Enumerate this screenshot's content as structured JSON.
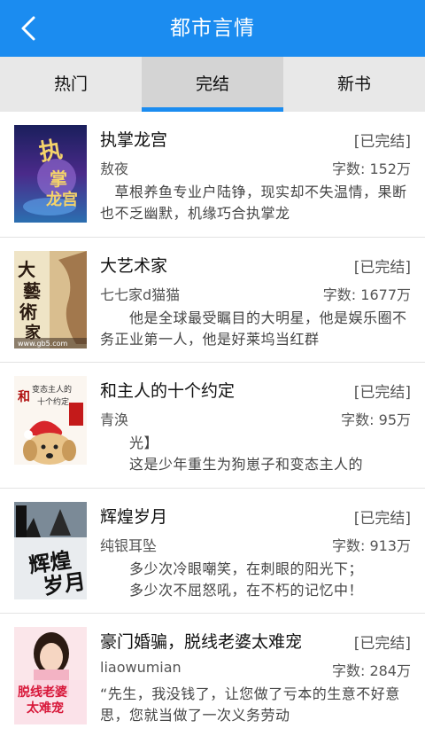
{
  "header": {
    "title": "都市言情",
    "back_icon": "chevron-left-icon"
  },
  "tabs": [
    {
      "label": "热门",
      "active": false
    },
    {
      "label": "完结",
      "active": true
    },
    {
      "label": "新书",
      "active": false
    }
  ],
  "books": [
    {
      "title": "执掌龙宫",
      "status": "[已完结]",
      "author": "敖夜",
      "word_count": "字数: 152万",
      "description": "　草根养鱼专业户陆铮，现实却不失温情，果断也不乏幽默，机缘巧合执掌龙",
      "cover_text": "执掌龙宫"
    },
    {
      "title": "大艺术家",
      "status": "[已完结]",
      "author": "七七家d猫猫",
      "word_count": "字数: 1677万",
      "description": "　　他是全球最受瞩目的大明星，他是娱乐圈不务正业第一人，他是好莱坞当红群",
      "cover_text": "大藝術家",
      "cover_watermark": "www.gb5.com"
    },
    {
      "title": "和主人的十个约定",
      "status": "[已完结]",
      "author": "青涣",
      "word_count": "字数: 95万",
      "description": "　　光】\n　　这是少年重生为狗崽子和变态主人的",
      "cover_text": "和变态主人的十个约定"
    },
    {
      "title": "辉煌岁月",
      "status": "[已完结]",
      "author": "纯银耳坠",
      "word_count": "字数: 913万",
      "description": "　　多少次冷眼嘲笑，在刺眼的阳光下；\n　　多少次不屈怒吼，在不朽的记忆中！",
      "cover_text": "辉煌岁月"
    },
    {
      "title": "豪门婚骗，脱线老婆太难宠",
      "status": "[已完结]",
      "author": "liaowumian",
      "word_count": "字数: 284万",
      "description": "“先生，我没钱了，让您做了亏本的生意不好意思，您就当做了一次义务劳动",
      "cover_text": "脱线老婆太难宠"
    }
  ],
  "colors": {
    "accent": "#1b8cf0",
    "tab_bg": "#e8e8e8",
    "tab_active_bg": "#d4d4d4"
  }
}
